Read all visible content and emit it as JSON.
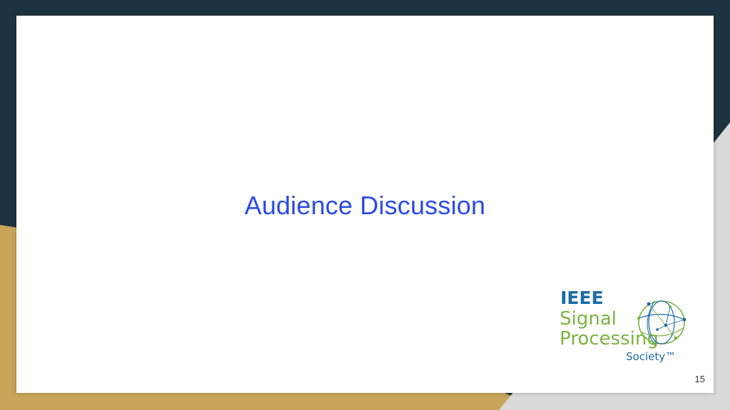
{
  "slide": {
    "title": "Audience Discussion",
    "page_number": "15"
  },
  "logo": {
    "line1": "IEEE",
    "line2": "Signal",
    "line3": "Processing",
    "line4": "Society™"
  },
  "colors": {
    "background_dark": "#1e3340",
    "background_gold": "#c9a55a",
    "background_gray": "#dadada",
    "title": "#2b4be6",
    "logo_blue": "#1b6ba6",
    "logo_green": "#7cb342"
  }
}
